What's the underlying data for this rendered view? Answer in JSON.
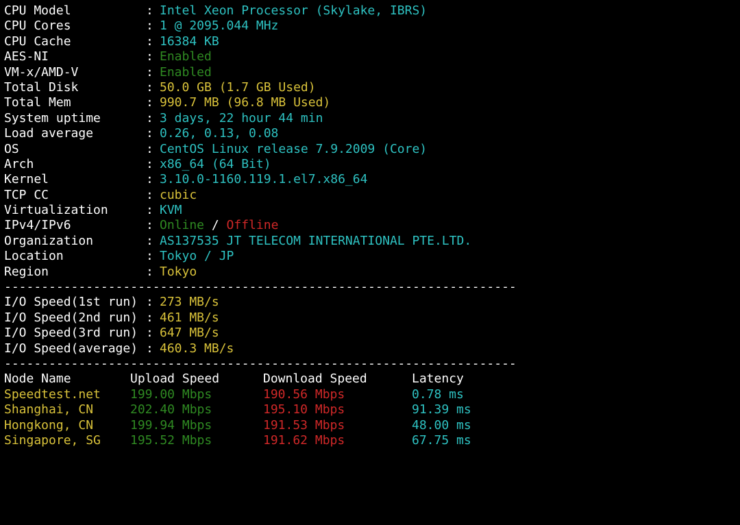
{
  "sysinfo": [
    {
      "label": "CPU Model",
      "value": "Intel Xeon Processor (Skylake, IBRS)",
      "color": "cyan"
    },
    {
      "label": "CPU Cores",
      "value": "1 @ 2095.044 MHz",
      "color": "cyan"
    },
    {
      "label": "CPU Cache",
      "value": "16384 KB",
      "color": "cyan"
    },
    {
      "label": "AES-NI",
      "value": "Enabled",
      "color": "green"
    },
    {
      "label": "VM-x/AMD-V",
      "value": "Enabled",
      "color": "green"
    },
    {
      "label": "Total Disk",
      "value": "50.0 GB (1.7 GB Used)",
      "color": "yellow"
    },
    {
      "label": "Total Mem",
      "value": "990.7 MB (96.8 MB Used)",
      "color": "yellow"
    },
    {
      "label": "System uptime",
      "value": "3 days, 22 hour 44 min",
      "color": "cyan"
    },
    {
      "label": "Load average",
      "value": "0.26, 0.13, 0.08",
      "color": "cyan"
    },
    {
      "label": "OS",
      "value": "CentOS Linux release 7.9.2009 (Core)",
      "color": "cyan"
    },
    {
      "label": "Arch",
      "value": "x86_64 (64 Bit)",
      "color": "cyan"
    },
    {
      "label": "Kernel",
      "value": "3.10.0-1160.119.1.el7.x86_64",
      "color": "cyan"
    },
    {
      "label": "TCP CC",
      "value": "cubic",
      "color": "yellow"
    },
    {
      "label": "Virtualization",
      "value": "KVM",
      "color": "cyan"
    }
  ],
  "ipv": {
    "label": "IPv4/IPv6",
    "online": "Online",
    "slash": " / ",
    "offline": "Offline"
  },
  "sysinfo2": [
    {
      "label": "Organization",
      "value": "AS137535 JT TELECOM INTERNATIONAL PTE.LTD.",
      "color": "cyan"
    },
    {
      "label": "Location",
      "value": "Tokyo / JP",
      "color": "cyan"
    },
    {
      "label": "Region",
      "value": "Tokyo",
      "color": "yellow"
    }
  ],
  "separator": ":",
  "divider": "----------------------------------------------------------------------",
  "io": [
    {
      "label": "I/O Speed(1st run)",
      "value": "273 MB/s"
    },
    {
      "label": "I/O Speed(2nd run)",
      "value": "461 MB/s"
    },
    {
      "label": "I/O Speed(3rd run)",
      "value": "647 MB/s"
    },
    {
      "label": "I/O Speed(average)",
      "value": "460.3 MB/s"
    }
  ],
  "speedtest": {
    "headers": {
      "node": "Node Name",
      "upload": "Upload Speed",
      "download": "Download Speed",
      "latency": "Latency"
    },
    "rows": [
      {
        "node": "Speedtest.net",
        "upload": "199.00 Mbps",
        "download": "190.56 Mbps",
        "latency": "0.78 ms"
      },
      {
        "node": "Shanghai, CN",
        "upload": "202.40 Mbps",
        "download": "195.10 Mbps",
        "latency": "91.39 ms"
      },
      {
        "node": "Hongkong, CN",
        "upload": "199.94 Mbps",
        "download": "191.53 Mbps",
        "latency": "48.00 ms"
      },
      {
        "node": "Singapore, SG",
        "upload": "195.52 Mbps",
        "download": "191.62 Mbps",
        "latency": "67.75 ms"
      }
    ]
  },
  "colors": {
    "cyan": "#2ec2c2",
    "green": "#2f8a22",
    "yellow": "#d9c23a",
    "red": "#d02828",
    "background": "#000000"
  }
}
